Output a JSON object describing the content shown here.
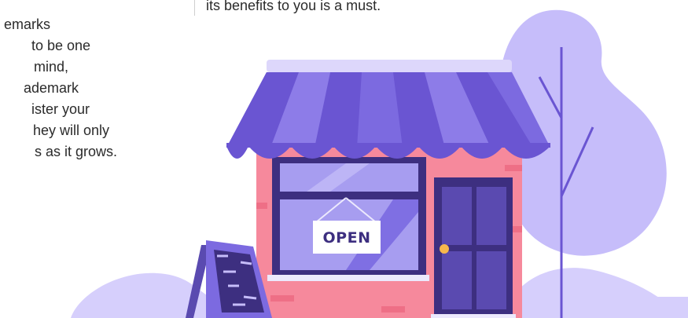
{
  "left_paragraph": {
    "lines": [
      "emarks",
      "to be one",
      "mind,",
      "ademark",
      "ister your",
      "hey will only",
      "s as it grows."
    ]
  },
  "right_paragraph": {
    "line": "its benefits to you is a must."
  },
  "storefront": {
    "sign_text": "OPEN",
    "colors": {
      "awning": "#7c6ae0",
      "wall": "#f6899c",
      "window": "#a79df0",
      "door": "#5a4ab0",
      "tree": "#c6bdfa",
      "ground": "#d6cffc"
    },
    "icons": [
      "awning-icon",
      "open-sign-icon",
      "chalkboard-sign-icon",
      "tree-icon",
      "door-icon"
    ]
  }
}
